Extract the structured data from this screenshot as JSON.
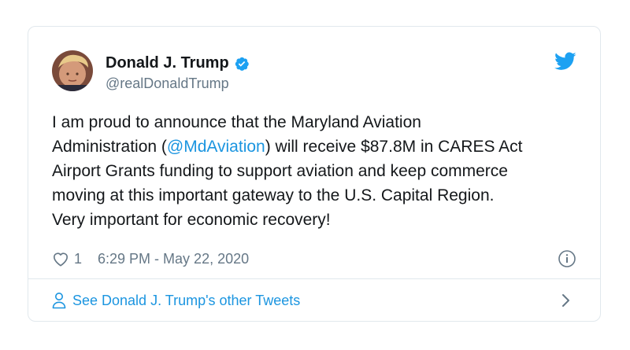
{
  "tweet": {
    "author": {
      "display_name": "Donald J. Trump",
      "handle": "@realDonaldTrump",
      "verified": true
    },
    "text_lines": [
      {
        "before": "I am proud to announce that the Maryland Aviation",
        "mention": "",
        "after": ""
      },
      {
        "before": "Administration (",
        "mention": "@MdAviation",
        "after": ") will receive $87.8M in CARES Act"
      },
      {
        "before": "Airport Grants funding to support aviation and keep commerce",
        "mention": "",
        "after": ""
      },
      {
        "before": "moving at this important gateway to the U.S. Capital Region.",
        "mention": "",
        "after": ""
      },
      {
        "before": "Very important for economic recovery!",
        "mention": "",
        "after": ""
      }
    ],
    "like_count": "1",
    "timestamp": "6:29 PM - May 22, 2020"
  },
  "footer": {
    "link_label": "See Donald J. Trump's other Tweets"
  },
  "colors": {
    "accent": "#1b95e0",
    "verified": "#1da1f2",
    "muted": "#657786",
    "border": "#e1e8ed"
  },
  "icons": [
    "avatar",
    "verified-badge-icon",
    "twitter-bird-icon",
    "heart-icon",
    "info-icon",
    "person-icon",
    "chevron-right-icon"
  ]
}
